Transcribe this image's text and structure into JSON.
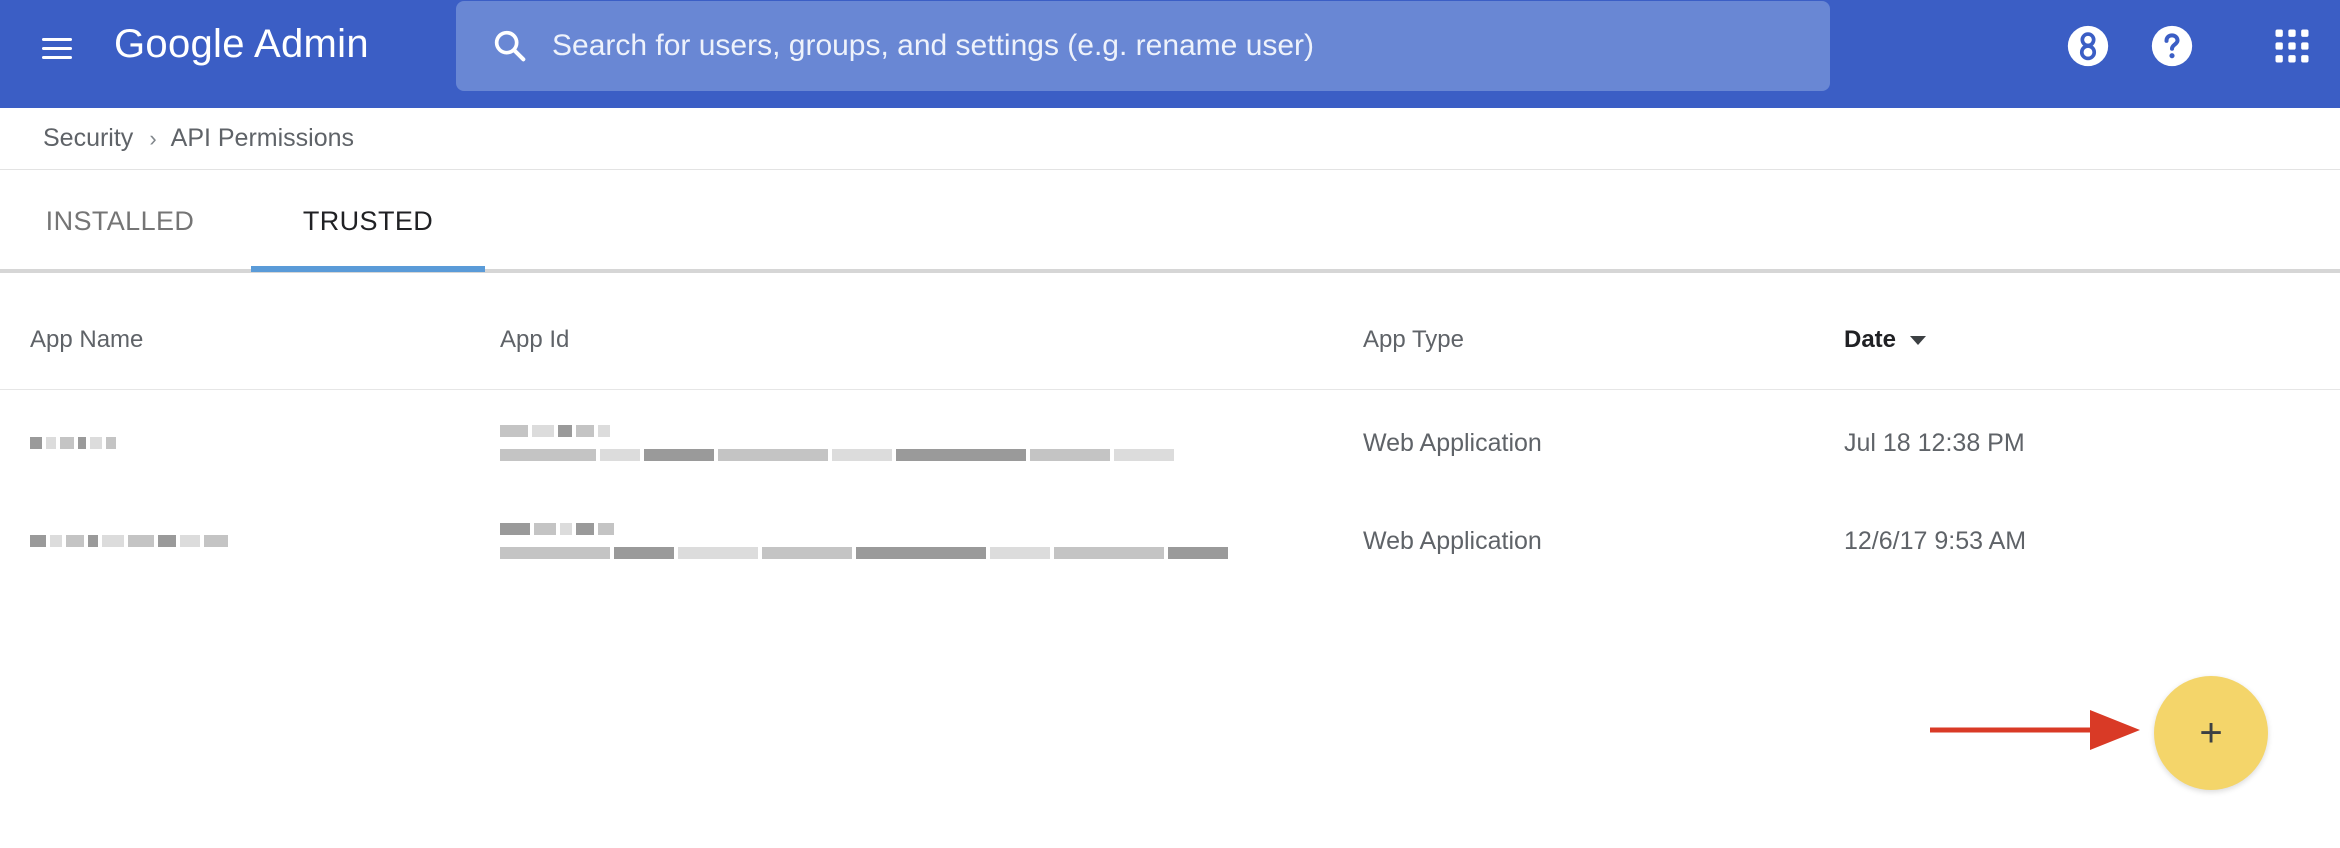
{
  "header": {
    "brand": "Google Admin",
    "search_placeholder": "Search for users, groups, and settings (e.g. rename user)",
    "icons": [
      "menu-icon",
      "search-icon",
      "support-icon",
      "help-icon",
      "apps-grid-icon"
    ]
  },
  "breadcrumb": {
    "items": [
      "Security",
      "API Permissions"
    ],
    "separator": "›"
  },
  "tabs": [
    {
      "label": "INSTALLED",
      "active": false
    },
    {
      "label": "TRUSTED",
      "active": true
    }
  ],
  "table": {
    "columns": [
      "App Name",
      "App Id",
      "App Type",
      "Date"
    ],
    "sort_column": "Date",
    "rows": [
      {
        "app_type": "Web Application",
        "date": "Jul 18  12:38 PM"
      },
      {
        "app_type": "Web Application",
        "date": "12/6/17  9:53 AM"
      }
    ]
  },
  "fab": {
    "label": "+"
  },
  "colors": {
    "topbar": "#3b5ec5",
    "search": "#6987d4",
    "tab_underline": "#5a9bd8",
    "fab": "#f4d56a",
    "arrow": "#d93a26"
  }
}
